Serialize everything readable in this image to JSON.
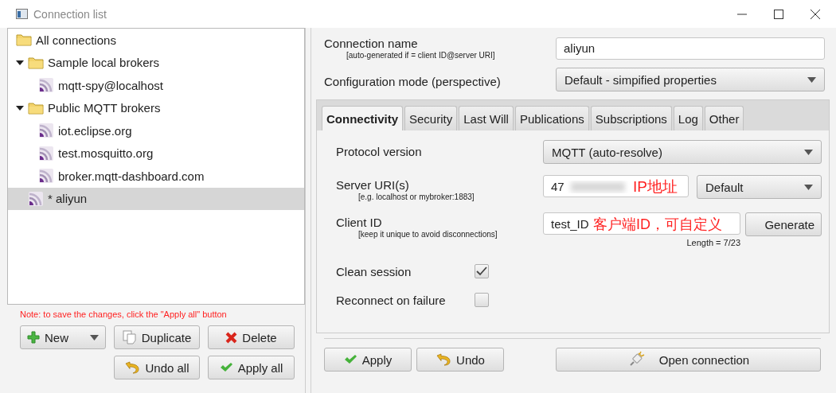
{
  "window": {
    "title": "Connection list"
  },
  "tree": [
    {
      "label": "All connections",
      "kind": "folder",
      "selected": false
    },
    {
      "label": "Sample local brokers",
      "kind": "folder",
      "expanded": true,
      "selected": false,
      "children": [
        {
          "label": "mqtt-spy@localhost",
          "kind": "connection",
          "selected": false
        }
      ]
    },
    {
      "label": "Public MQTT brokers",
      "kind": "folder",
      "expanded": true,
      "selected": false,
      "children": [
        {
          "label": "iot.eclipse.org",
          "kind": "connection",
          "selected": false
        },
        {
          "label": "test.mosquitto.org",
          "kind": "connection",
          "selected": false
        },
        {
          "label": "broker.mqtt-dashboard.com",
          "kind": "connection",
          "selected": false
        }
      ]
    },
    {
      "label": "* aliyun",
      "kind": "connection",
      "selected": true
    }
  ],
  "note": "Note: to save the changes, click the \"Apply all\" button",
  "list_buttons": [
    {
      "label": "New",
      "kind": "new"
    },
    {
      "label": "Duplicate",
      "kind": "duplicate"
    },
    {
      "label": "Delete",
      "kind": "delete"
    },
    {
      "label": "Undo all",
      "kind": "undo"
    },
    {
      "label": "Apply all",
      "kind": "apply"
    }
  ],
  "connection_name": {
    "label": "Connection name",
    "hint": "[auto-generated if = client ID@server URI]",
    "value": "aliyun"
  },
  "configuration_mode": {
    "label": "Configuration mode (perspective)",
    "value": "Default - simpified properties"
  },
  "tabs": [
    {
      "label": "Connectivity",
      "selected": true
    },
    {
      "label": "Security",
      "selected": false
    },
    {
      "label": "Last Will",
      "selected": false
    },
    {
      "label": "Publications",
      "selected": false
    },
    {
      "label": "Subscriptions",
      "selected": false
    },
    {
      "label": "Log",
      "selected": false
    },
    {
      "label": "Other",
      "selected": false
    }
  ],
  "protocol_version": {
    "label": "Protocol version",
    "value": "MQTT (auto-resolve)"
  },
  "server_uri": {
    "label": "Server URI(s)",
    "hint": "[e.g. localhost or mybroker:1883]",
    "value": "47",
    "annotation": "IP地址",
    "mode": "Default"
  },
  "client_id": {
    "label": "Client ID",
    "hint": "[keep it unique to avoid disconnections]",
    "value": "test_ID",
    "annotation": "客户端ID，可自定义",
    "button": "Generate",
    "length": "Length = 7/23"
  },
  "options": [
    {
      "label": "Clean session",
      "checked": true
    },
    {
      "label": "Reconnect on failure",
      "checked": false
    }
  ],
  "actions": [
    {
      "label": "Apply",
      "kind": "apply"
    },
    {
      "label": "Undo",
      "kind": "undo"
    },
    {
      "label": "Open connection",
      "kind": "open"
    }
  ]
}
